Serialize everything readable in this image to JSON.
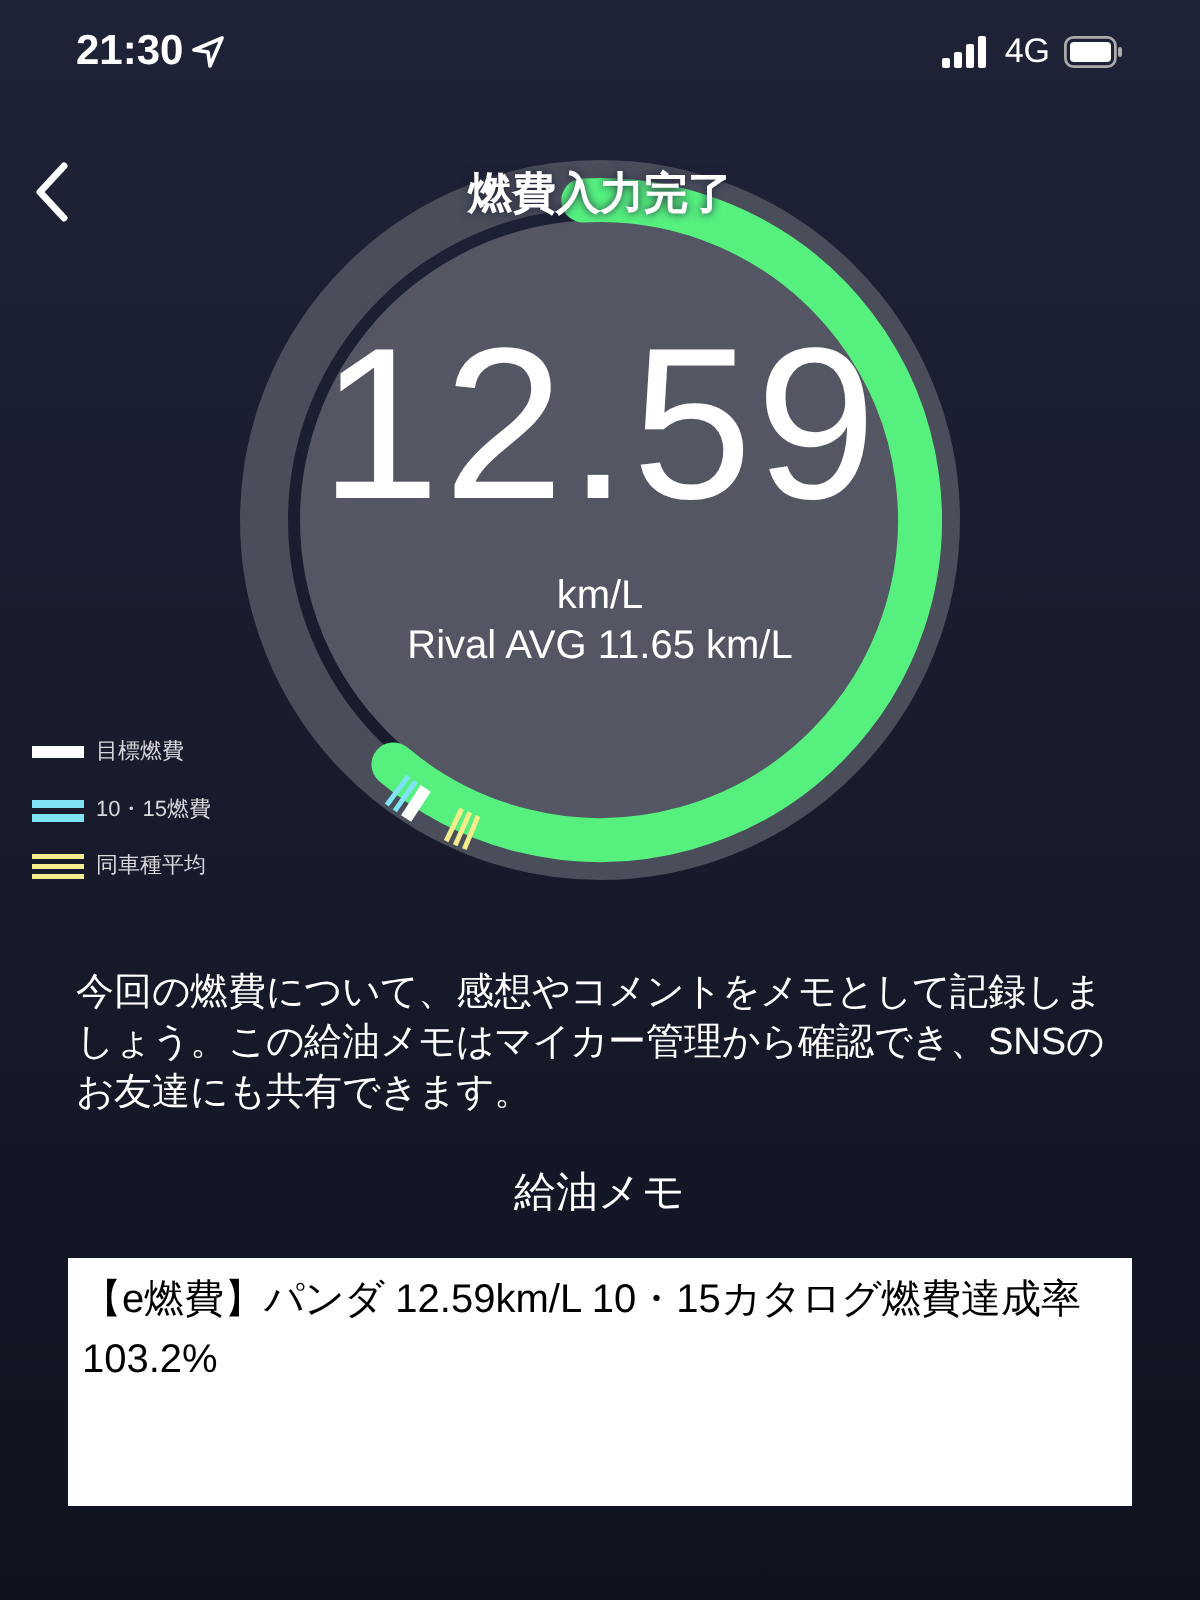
{
  "status_bar": {
    "time": "21:30",
    "network": "4G"
  },
  "header": {
    "title": "燃費入力完了"
  },
  "gauge": {
    "value": "12.59",
    "unit": "km/L",
    "rival": "Rival AVG 11.65 km/L"
  },
  "legend": [
    {
      "kind": "target",
      "label": "目標燃費"
    },
    {
      "kind": "catalog",
      "label": "10・15燃費"
    },
    {
      "kind": "average",
      "label": "同車種平均"
    }
  ],
  "description": "今回の燃費について、感想やコメントをメモとして記録しましょう。この給油メモはマイカー管理から確認でき、SNSのお友達にも共有できます。",
  "memo": {
    "title": "給油メモ",
    "value": "【e燃費】パンダ 12.59km/L 10・15カタログ燃費達成率103.2%"
  }
}
